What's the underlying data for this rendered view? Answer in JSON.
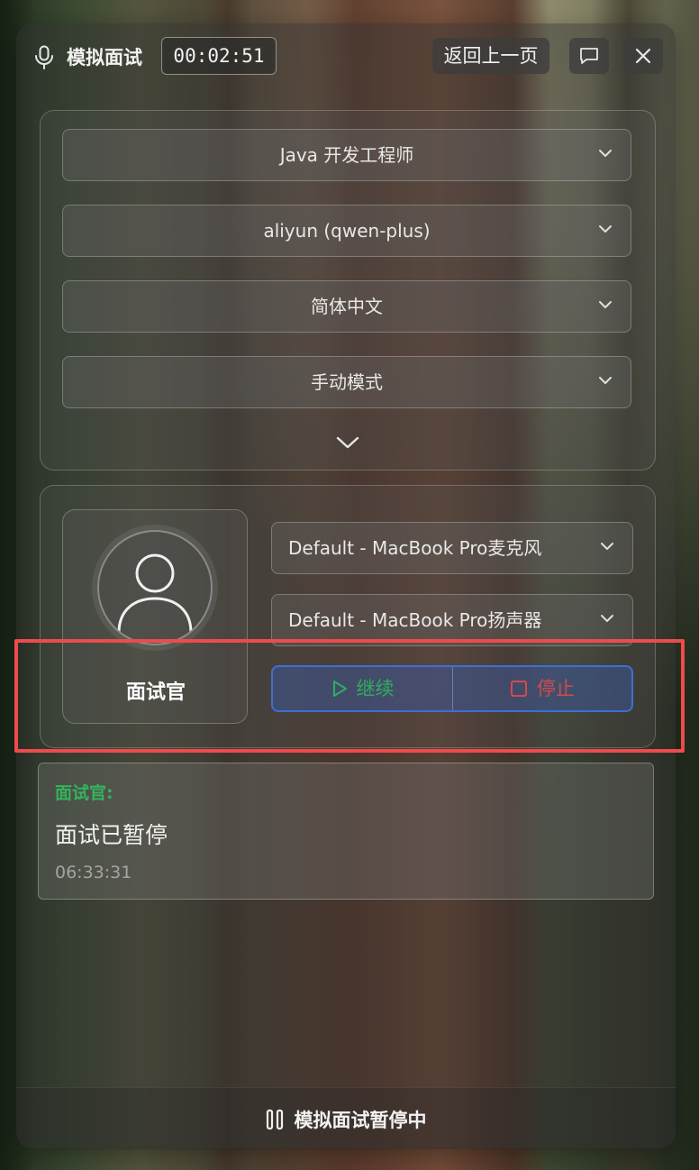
{
  "header": {
    "title": "模拟面试",
    "timer": "00:02:51",
    "back_label": "返回上一页"
  },
  "config": {
    "role": "Java 开发工程师",
    "model": "aliyun (qwen-plus)",
    "language": "简体中文",
    "mode": "手动模式"
  },
  "devices": {
    "microphone": "Default - MacBook Pro麦克风",
    "speaker": "Default - MacBook Pro扬声器"
  },
  "interviewer": {
    "name": "面试官"
  },
  "controls": {
    "continue_label": "继续",
    "stop_label": "停止"
  },
  "messages": [
    {
      "speaker": "面试官:",
      "text": "面试已暂停",
      "time": "06:33:31"
    }
  ],
  "status": {
    "text": "模拟面试暂停中"
  },
  "colors": {
    "accent_blue": "#3d6fd6",
    "continue_green": "#2fae5c",
    "stop_red": "#d44a4a",
    "speaker_green": "#33b35c",
    "highlight_red": "#ee4b4b"
  }
}
